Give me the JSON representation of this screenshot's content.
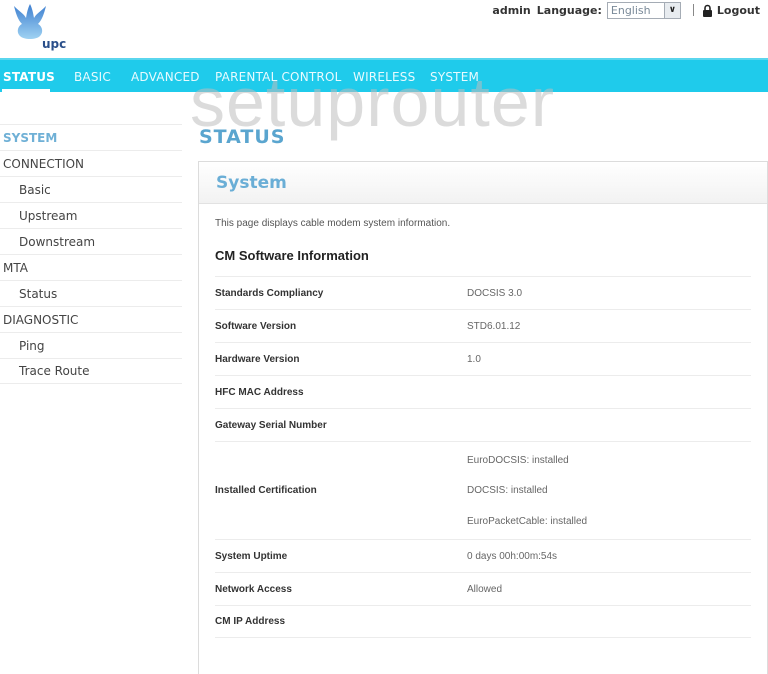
{
  "header": {
    "logo_text": "upc",
    "user": "admin",
    "language_label": "Language:",
    "language_selected": "English",
    "logout_label": "Logout"
  },
  "nav": {
    "items": [
      {
        "label": "STATUS",
        "active": true
      },
      {
        "label": "BASIC"
      },
      {
        "label": "ADVANCED"
      },
      {
        "label": "PARENTAL CONTROL"
      },
      {
        "label": "WIRELESS"
      },
      {
        "label": "SYSTEM"
      }
    ]
  },
  "watermark": "setuprouter",
  "sidebar": {
    "items": [
      {
        "label": "SYSTEM",
        "level": "top",
        "active": true
      },
      {
        "label": "CONNECTION",
        "level": "top"
      },
      {
        "label": "Basic",
        "level": "sub"
      },
      {
        "label": "Upstream",
        "level": "sub"
      },
      {
        "label": "Downstream",
        "level": "sub"
      },
      {
        "label": "MTA",
        "level": "top"
      },
      {
        "label": "Status",
        "level": "sub"
      },
      {
        "label": "DIAGNOSTIC",
        "level": "top"
      },
      {
        "label": "Ping",
        "level": "sub"
      },
      {
        "label": "Trace Route",
        "level": "sub"
      }
    ]
  },
  "main": {
    "page_title": "STATUS",
    "panel_title": "System",
    "description": "This page displays cable modem system information.",
    "section_title": "CM Software Information",
    "rows": [
      {
        "label": "Standards Compliancy",
        "value": "DOCSIS 3.0"
      },
      {
        "label": "Software Version",
        "value": "STD6.01.12"
      },
      {
        "label": "Hardware Version",
        "value": "1.0"
      },
      {
        "label": "HFC MAC Address",
        "value": ""
      },
      {
        "label": "Gateway Serial Number",
        "value": ""
      },
      {
        "label": "Installed Certification",
        "values": [
          "EuroDOCSIS: installed",
          "DOCSIS: installed",
          "EuroPacketCable: installed"
        ]
      },
      {
        "label": "System Uptime",
        "value": "0 days 00h:00m:54s"
      },
      {
        "label": "Network Access",
        "value": "Allowed"
      },
      {
        "label": "CM IP Address",
        "value": ""
      }
    ]
  }
}
